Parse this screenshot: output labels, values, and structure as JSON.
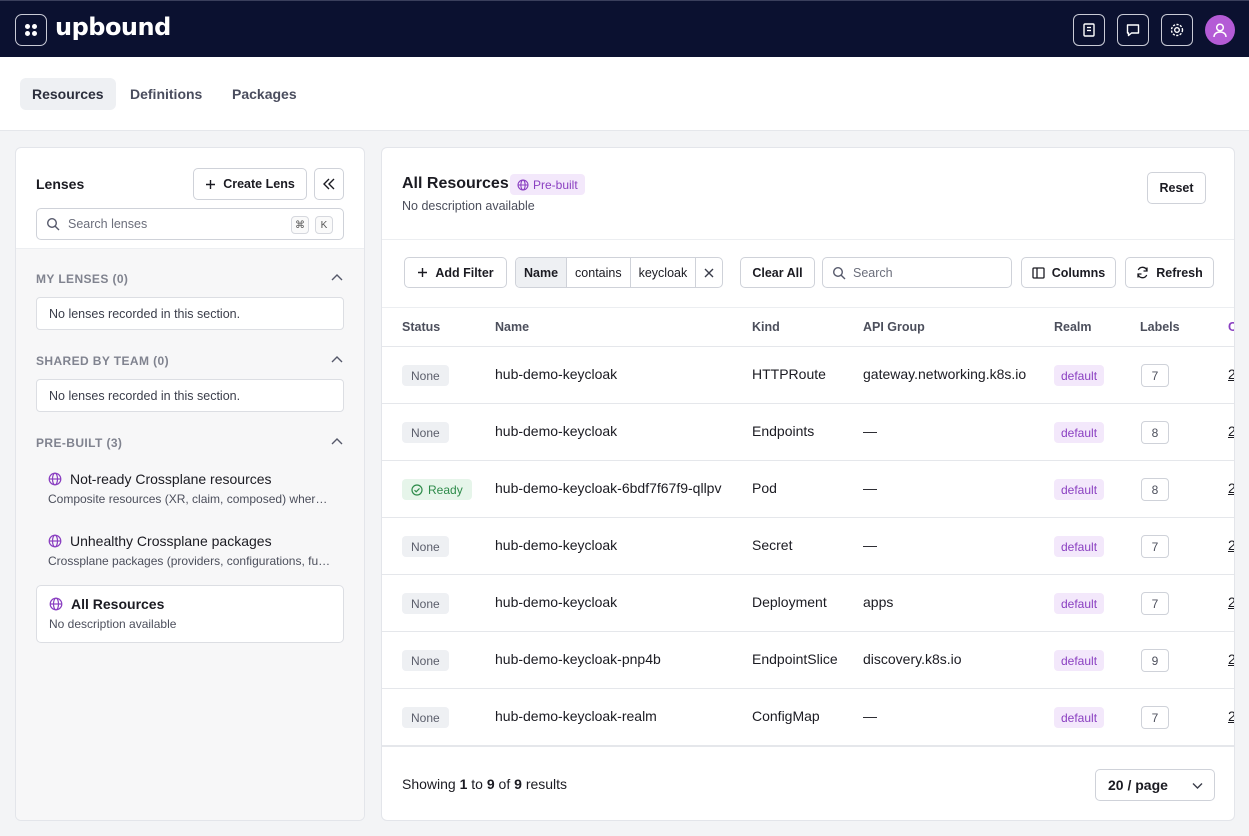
{
  "app": {
    "logo": "upbound"
  },
  "tabs": [
    {
      "label": "Resources",
      "active": true
    },
    {
      "label": "Definitions",
      "active": false
    },
    {
      "label": "Packages",
      "active": false
    }
  ],
  "lenses": {
    "title": "Lenses",
    "create_label": "Create Lens",
    "search_placeholder": "Search lenses",
    "shortcut": [
      "⌘",
      "K"
    ],
    "sections": [
      {
        "title": "MY LENSES (0)",
        "empty_text": "No lenses recorded in this section."
      },
      {
        "title": "SHARED BY TEAM (0)",
        "empty_text": "No lenses recorded in this section."
      },
      {
        "title": "PRE-BUILT (3)"
      }
    ],
    "prebuilt": [
      {
        "name": "Not-ready Crossplane resources",
        "desc": "Composite resources (XR, claim, composed) where not ready"
      },
      {
        "name": "Unhealthy Crossplane packages",
        "desc": "Crossplane packages (providers, configurations, functions) unhealthy"
      },
      {
        "name": "All Resources",
        "desc": "No description available",
        "selected": true
      }
    ]
  },
  "main": {
    "title": "All Resources",
    "badge": "Pre-built",
    "desc": "No description available",
    "reset_label": "Reset",
    "add_filter_label": "Add Filter",
    "filter": {
      "field": "Name",
      "op": "contains",
      "value": "keycloak"
    },
    "clear_all_label": "Clear All",
    "search_placeholder": "Search",
    "columns_label": "Columns",
    "refresh_label": "Refresh",
    "headers": [
      "Status",
      "Name",
      "Kind",
      "API Group",
      "Realm",
      "Labels",
      "C"
    ],
    "rows": [
      {
        "status": "None",
        "name": "hub-demo-keycloak",
        "kind": "HTTPRoute",
        "api_group": "gateway.networking.k8s.io",
        "realm": "default",
        "labels": "7",
        "extra": "2"
      },
      {
        "status": "None",
        "name": "hub-demo-keycloak",
        "kind": "Endpoints",
        "api_group": "—",
        "realm": "default",
        "labels": "8",
        "extra": "2"
      },
      {
        "status": "Ready",
        "name": "hub-demo-keycloak-6bdf7f67f9-qllpv",
        "kind": "Pod",
        "api_group": "—",
        "realm": "default",
        "labels": "8",
        "extra": "2"
      },
      {
        "status": "None",
        "name": "hub-demo-keycloak",
        "kind": "Secret",
        "api_group": "—",
        "realm": "default",
        "labels": "7",
        "extra": "2"
      },
      {
        "status": "None",
        "name": "hub-demo-keycloak",
        "kind": "Deployment",
        "api_group": "apps",
        "realm": "default",
        "labels": "7",
        "extra": "2"
      },
      {
        "status": "None",
        "name": "hub-demo-keycloak-pnp4b",
        "kind": "EndpointSlice",
        "api_group": "discovery.k8s.io",
        "realm": "default",
        "labels": "9",
        "extra": "2"
      },
      {
        "status": "None",
        "name": "hub-demo-keycloak-realm",
        "kind": "ConfigMap",
        "api_group": "—",
        "realm": "default",
        "labels": "7",
        "extra": "2"
      }
    ],
    "footer": {
      "showing": "Showing",
      "from": "1",
      "to_word": "to",
      "to": "9",
      "of_word": "of",
      "total": "9",
      "results": "results"
    },
    "page_size": "20 / page"
  },
  "colors": {
    "topbar": "#0b1130",
    "accent": "#8a3fc1",
    "ready": "#2e8b4a"
  }
}
